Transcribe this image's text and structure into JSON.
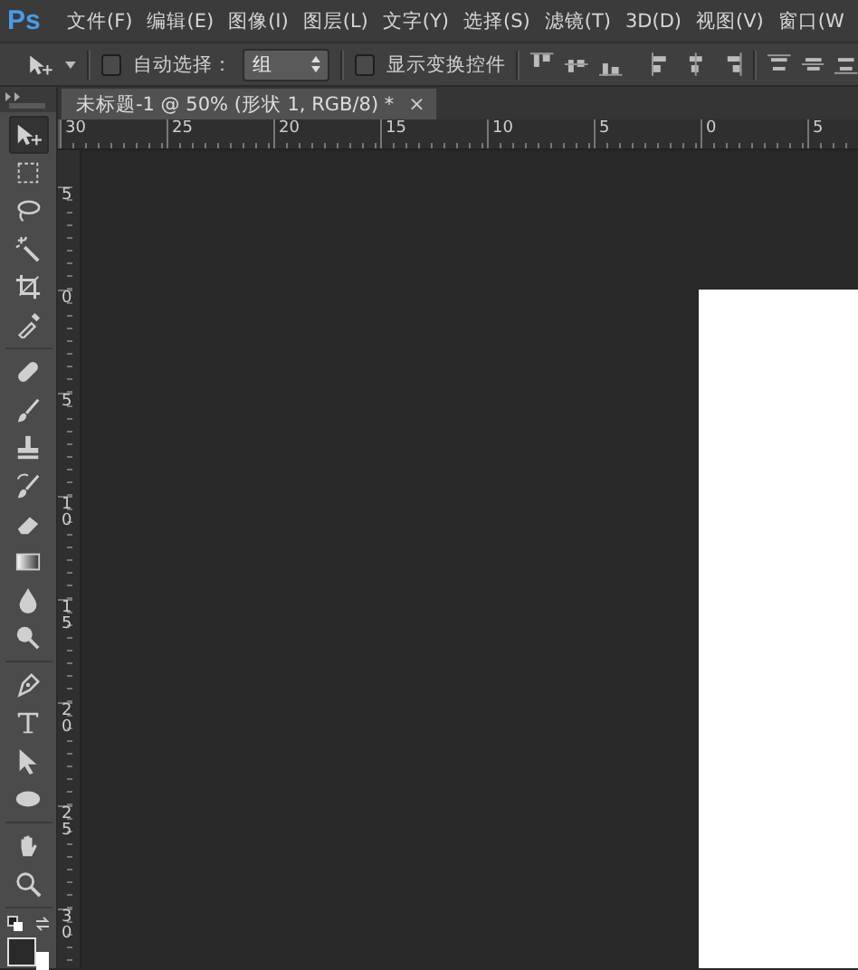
{
  "menu_bar": {
    "logo": "Ps",
    "items": [
      "文件(F)",
      "编辑(E)",
      "图像(I)",
      "图层(L)",
      "文字(Y)",
      "选择(S)",
      "滤镜(T)",
      "3D(D)",
      "视图(V)",
      "窗口(W"
    ]
  },
  "options_bar": {
    "auto_select": {
      "label": "自动选择：",
      "checked": false
    },
    "auto_select_target": {
      "value": "组"
    },
    "show_transform": {
      "label": "显示变换控件",
      "checked": false
    }
  },
  "document_tab": {
    "title": "未标题-1 @ 50% (形状 1, RGB/8) *",
    "close": "×"
  },
  "rulers": {
    "horizontal": [
      "30",
      "25",
      "20",
      "15",
      "10",
      "5",
      "0",
      "5"
    ],
    "vertical": [
      "5",
      "0",
      "5",
      "10",
      "15",
      "20",
      "25",
      "30"
    ]
  },
  "toolbox": {
    "groups": [
      [
        {
          "kind": "move",
          "selected": true
        },
        {
          "kind": "marquee",
          "selected": false
        },
        {
          "kind": "lasso",
          "selected": false
        },
        {
          "kind": "wand",
          "selected": false
        },
        {
          "kind": "crop",
          "selected": false
        },
        {
          "kind": "eyedropper",
          "selected": false
        }
      ],
      [
        {
          "kind": "bandage",
          "selected": false
        },
        {
          "kind": "brush",
          "selected": false
        },
        {
          "kind": "stamp",
          "selected": false
        },
        {
          "kind": "history",
          "selected": false
        },
        {
          "kind": "eraser",
          "selected": false
        },
        {
          "kind": "gradient",
          "selected": false
        },
        {
          "kind": "drop",
          "selected": false
        },
        {
          "kind": "dodge",
          "selected": false
        }
      ],
      [
        {
          "kind": "pen",
          "selected": false
        },
        {
          "kind": "type",
          "selected": false
        },
        {
          "kind": "pointer",
          "selected": false
        },
        {
          "kind": "ellipse",
          "selected": false
        }
      ],
      [
        {
          "kind": "hand",
          "selected": false
        },
        {
          "kind": "zoom",
          "selected": false
        }
      ]
    ]
  }
}
